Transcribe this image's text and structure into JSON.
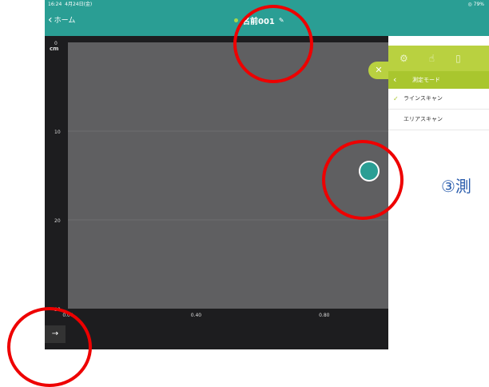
{
  "status_bar": {
    "time": "16:24",
    "date": "4月24日(金)",
    "battery": "◎ 79%"
  },
  "nav": {
    "back_label": "ホーム",
    "title": "名前001",
    "title_dot_color": "#a8d84a",
    "pencil_icon": "pencil-icon"
  },
  "chart_data": {
    "type": "scatter",
    "title": "",
    "ylabel": "cm",
    "xlim": [
      0,
      1.0
    ],
    "ylim": [
      0,
      30
    ],
    "y_inverted": true,
    "x_ticks": [
      "0.00",
      "0.40",
      "0.80"
    ],
    "x_tick_values": [
      0.0,
      0.4,
      0.8
    ],
    "y_ticks": [
      "0",
      "10",
      "20",
      "30"
    ],
    "y_tick_values": [
      0,
      10,
      20,
      30
    ],
    "points": [
      {
        "x": 1.0,
        "y": 14.5
      }
    ],
    "plot_color": "#5f5f61",
    "point_color": "#2a9e94",
    "grid": true
  },
  "side_panel": {
    "close_label": "✕",
    "icons": [
      "settings-icon",
      "touch-icon",
      "sidebar-icon"
    ],
    "header_title": "測定モード",
    "modes": [
      {
        "label": "ラインスキャン",
        "selected": true
      },
      {
        "label": "エリアスキャン",
        "selected": false
      }
    ],
    "step_text": "③測"
  },
  "bottom": {
    "go_button": "→"
  },
  "accent_colors": {
    "teal": "#2a9e94",
    "lime": "#b9d140",
    "marker": "#e00000"
  }
}
